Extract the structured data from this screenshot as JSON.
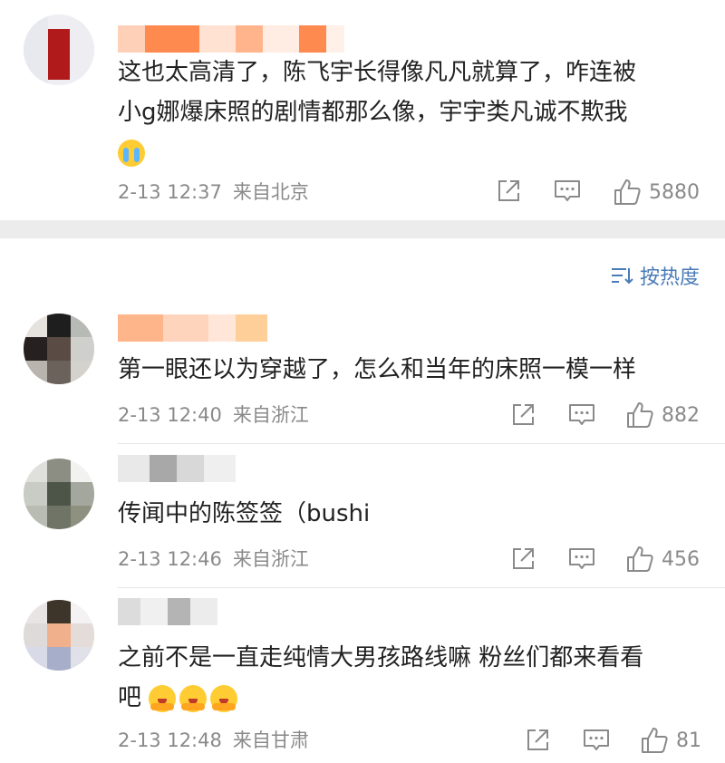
{
  "colors": {
    "accent": "#4a7bb7",
    "meta_gray": "#8a8a8a",
    "text": "#222222",
    "band": "#ececec"
  },
  "sort": {
    "label": "按热度",
    "icon": "sort-icon"
  },
  "comments": [
    {
      "text_line1": "这也太高清了，陈飞宇长得像凡凡就算了，咋连被",
      "text_line2": "小g娜爆床照的剧情都那么像，宇宇类凡诚不欺我",
      "emoji": "crying-emoji",
      "time": "2-13 12:37",
      "location": "来自北京",
      "likes": "5880"
    },
    {
      "text_line1": "第一眼还以为穿越了，怎么和当年的床照一模一样",
      "time": "2-13 12:40",
      "location": "来自浙江",
      "likes": "882"
    },
    {
      "text_line1": "传闻中的陈签签（bushi",
      "time": "2-13 12:46",
      "location": "来自浙江",
      "likes": "456"
    },
    {
      "text_line1": "之前不是一直走纯情大男孩路线嘛 粉丝们都来看看",
      "text_line2": "吧",
      "emoji": "hugging-emoji",
      "time": "2-13 12:48",
      "location": "来自甘肃",
      "likes": "81"
    }
  ]
}
